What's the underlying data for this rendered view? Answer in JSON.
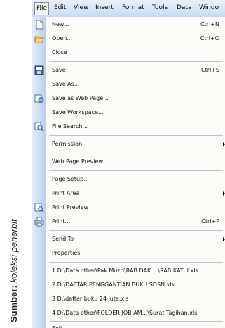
{
  "caption": {
    "bold": "Sumber:",
    "italic": "koleksi penerbit"
  },
  "menubar": {
    "items": [
      "File",
      "Edit",
      "View",
      "Insert",
      "Format",
      "Tools",
      "Data",
      "Windo"
    ]
  },
  "file_menu": {
    "new": {
      "label": "New...",
      "shortcut": "Ctrl+N",
      "icon": "new-document-icon"
    },
    "open": {
      "label": "Open...",
      "shortcut": "Ctrl+O",
      "icon": "open-folder-icon"
    },
    "close": {
      "label": "Close"
    },
    "save": {
      "label": "Save",
      "shortcut": "Ctrl+S",
      "icon": "save-disk-icon"
    },
    "save_as": {
      "label": "Save As..."
    },
    "save_web": {
      "label": "Save as Web Page...",
      "icon": "web-page-icon"
    },
    "save_workspace": {
      "label": "Save Workspace..."
    },
    "file_search": {
      "label": "File Search...",
      "icon": "file-search-icon"
    },
    "permission": {
      "label": "Permission"
    },
    "web_preview": {
      "label": "Web Page Preview"
    },
    "page_setup": {
      "label": "Page Setup..."
    },
    "print_area": {
      "label": "Print Area"
    },
    "print_preview": {
      "label": "Print Preview",
      "icon": "print-preview-icon"
    },
    "print": {
      "label": "Print...",
      "shortcut": "Ctrl+P",
      "icon": "printer-icon"
    },
    "send_to": {
      "label": "Send To"
    },
    "properties": {
      "label": "Properties"
    },
    "recent": [
      "1 D:\\Data other\\Pak Muzri\\RAB DAK ...\\RAB KAT II.xls",
      "2 D:\\DAFTAR PENGGANTIAN BUKU SDSN.xls",
      "3 D:\\daftar buku 24 juta.xls",
      "4 D:\\Data other\\FOLDER JOB AM...\\Surat Tagihan.xls"
    ],
    "exit": {
      "label": "Exit"
    }
  }
}
